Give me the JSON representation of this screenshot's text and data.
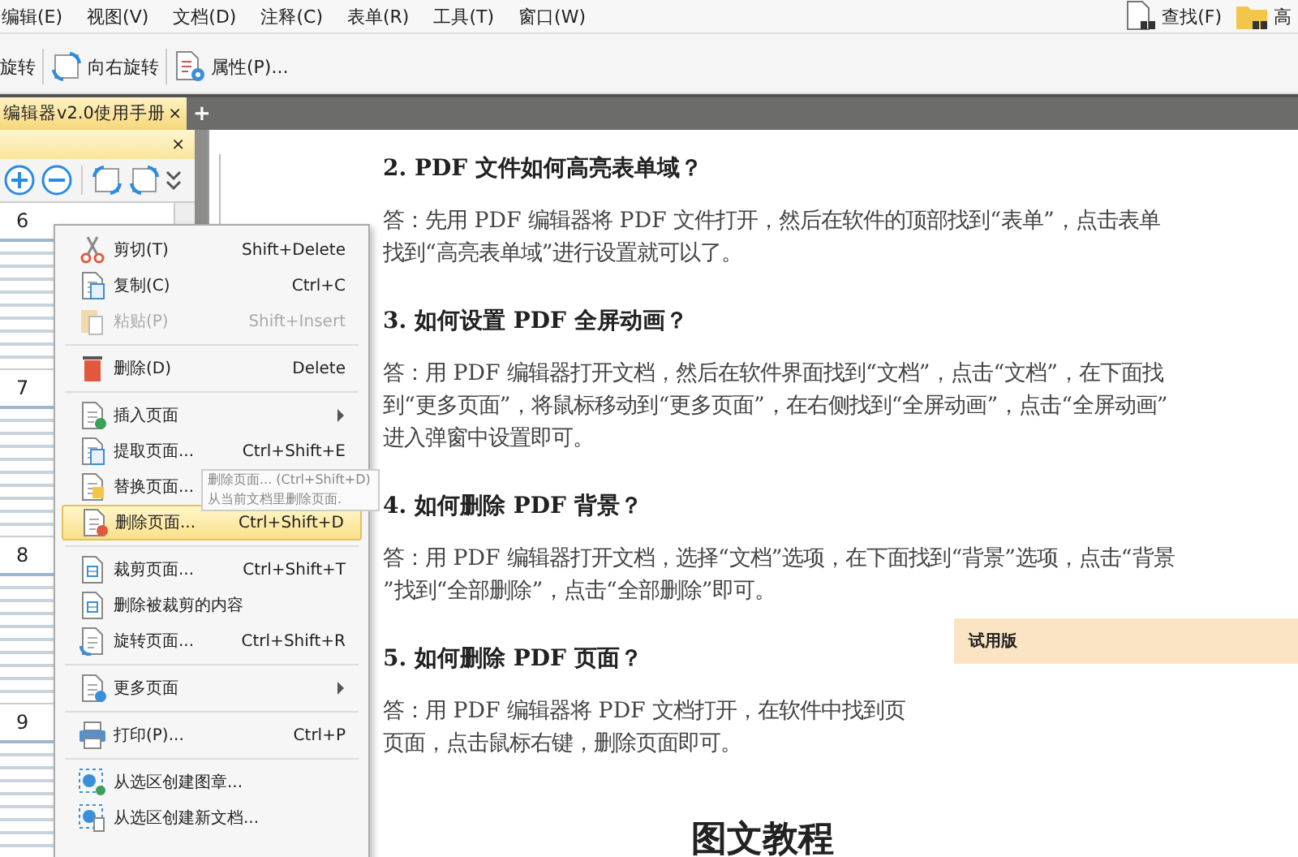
{
  "menu_bar": [
    "编辑(E)",
    "视图(V)",
    "文档(D)",
    "注释(C)",
    "表单(R)",
    "工具(T)",
    "窗口(W)"
  ],
  "search_tools": [
    {
      "label": "查找(F)",
      "kind": "find"
    },
    {
      "label": "高",
      "kind": "advanced"
    }
  ],
  "toolbar": [
    {
      "label": "旋转",
      "kind": "rotate-left"
    },
    {
      "label": "向右旋转",
      "kind": "rotate-right"
    },
    {
      "label": "属性(P)...",
      "kind": "properties"
    }
  ],
  "document_tab": {
    "title": "编辑器v2.0使用手册",
    "close": "×",
    "add": "+"
  },
  "thumbnail_panel": {
    "close": "×",
    "pages": [
      {
        "number": "6"
      },
      {
        "number": "7"
      },
      {
        "number": "8"
      },
      {
        "number": "9"
      }
    ]
  },
  "context_menu": {
    "groups": [
      [
        {
          "label": "剪切(T)",
          "shortcut": "Shift+Delete",
          "disabled": false,
          "selected": false,
          "submenu": false
        },
        {
          "label": "复制(C)",
          "shortcut": "Ctrl+C",
          "disabled": false,
          "selected": false,
          "submenu": false
        },
        {
          "label": "粘贴(P)",
          "shortcut": "Shift+Insert",
          "disabled": true,
          "selected": false,
          "submenu": false
        }
      ],
      [
        {
          "label": "删除(D)",
          "shortcut": "Delete",
          "disabled": false,
          "selected": false,
          "submenu": false
        }
      ],
      [
        {
          "label": "插入页面",
          "disabled": false,
          "selected": false,
          "submenu": true
        },
        {
          "label": "提取页面...",
          "shortcut": "Ctrl+Shift+E",
          "disabled": false,
          "selected": false,
          "submenu": false
        },
        {
          "label": "替换页面...",
          "disabled": false,
          "selected": false,
          "submenu": false
        },
        {
          "label": "删除页面...",
          "shortcut": "Ctrl+Shift+D",
          "disabled": false,
          "selected": true,
          "submenu": false
        }
      ],
      [
        {
          "label": "裁剪页面...",
          "shortcut": "Ctrl+Shift+T",
          "disabled": false,
          "selected": false,
          "submenu": false
        },
        {
          "label": "删除被裁剪的内容",
          "disabled": false,
          "selected": false,
          "submenu": false
        },
        {
          "label": "旋转页面...",
          "shortcut": "Ctrl+Shift+R",
          "disabled": false,
          "selected": false,
          "submenu": false
        }
      ],
      [
        {
          "label": "更多页面",
          "disabled": false,
          "selected": false,
          "submenu": true
        }
      ],
      [
        {
          "label": "打印(P)...",
          "shortcut": "Ctrl+P",
          "disabled": false,
          "selected": false,
          "submenu": false
        }
      ],
      [
        {
          "label": "从选区创建图章...",
          "disabled": false,
          "selected": false,
          "submenu": false
        },
        {
          "label": "从选区创建新文档...",
          "disabled": false,
          "selected": false,
          "submenu": false
        }
      ]
    ]
  },
  "tooltip": {
    "title": "删除页面... (Ctrl+Shift+D)",
    "description": "从当前文档里删除页面."
  },
  "document": {
    "sections": [
      {
        "heading": "2. PDF 文件如何高亮表单域？",
        "answer": "答：先用 PDF 编辑器将 PDF 文件打开，然后在软件的顶部找到“表单”，点击表单找到“高亮表单域”进行设置就可以了。"
      },
      {
        "heading": "3. 如何设置 PDF 全屏动画？",
        "answer": "答：用 PDF 编辑器打开文档，然后在软件界面找到“文档”，点击“文档”，在下面找到“更多页面”，将鼠标移动到“更多页面”，在右侧找到“全屏动画”，点击“全屏动画”进入弹窗中设置即可。"
      },
      {
        "heading": "4. 如何删除 PDF 背景？",
        "answer": "答：用 PDF 编辑器打开文档，选择“文档”选项，在下面找到“背景”选项，点击“背景”找到“全部删除”，点击“全部删除”即可。"
      },
      {
        "heading": "5. 如何删除 PDF 页面？",
        "answer": "答：用 PDF 编辑器将 PDF 文档打开，在软件中找到页",
        "answer_continued": "页面，点击鼠标右键，删除页面即可。"
      }
    ],
    "footer_heading": "图文教程"
  },
  "trial_panel": {
    "title": "试用版"
  }
}
